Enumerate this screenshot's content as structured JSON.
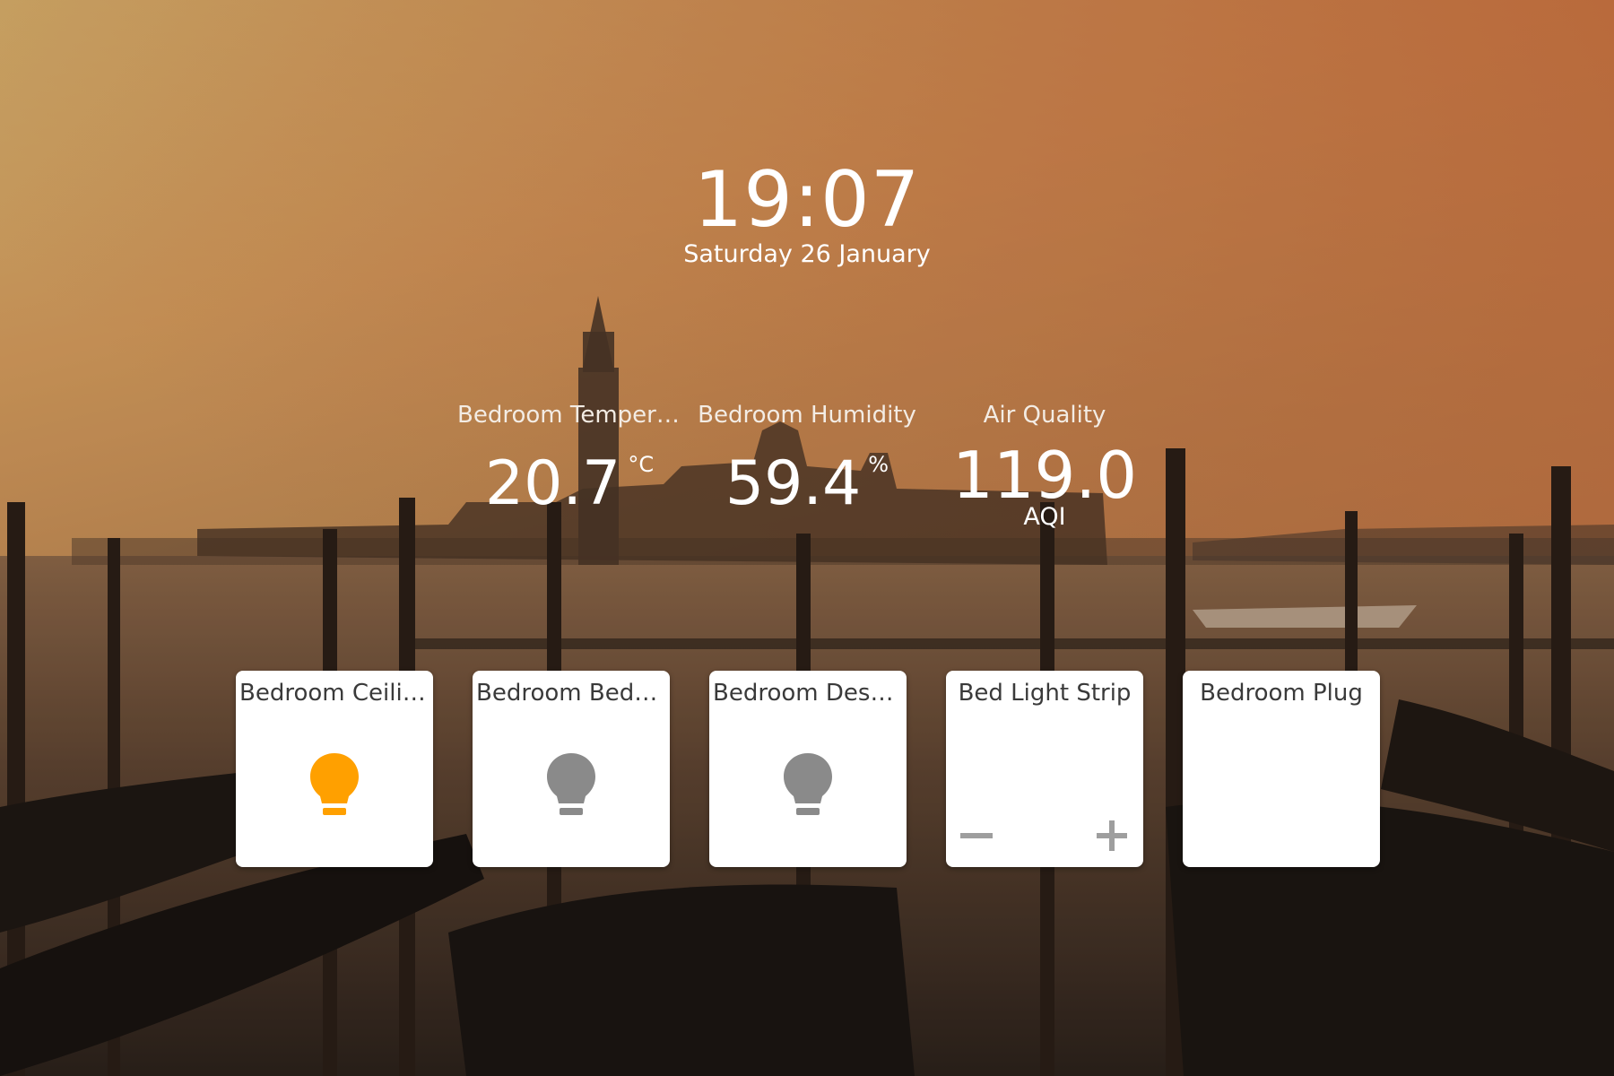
{
  "clock": {
    "time": "19:07",
    "date": "Saturday 26 January"
  },
  "sensors": [
    {
      "name": "Bedroom Temperature",
      "value": "20.7",
      "unit": "°C"
    },
    {
      "name": "Bedroom Humidity",
      "value": "59.4",
      "unit": "%"
    },
    {
      "name": "Air Quality",
      "value": "119.0",
      "unit": "AQI"
    }
  ],
  "tiles": [
    {
      "name": "Bedroom Ceiling",
      "icon": "lightbulb-icon",
      "state": "on"
    },
    {
      "name": "Bedroom Bedside",
      "icon": "lightbulb-icon",
      "state": "off"
    },
    {
      "name": "Bedroom Desk Lamp",
      "icon": "lightbulb-icon",
      "state": "off"
    },
    {
      "name": "Bed Light Strip",
      "controls": [
        "minus-icon",
        "plus-icon"
      ]
    },
    {
      "name": "Bedroom Plug"
    }
  ],
  "colors": {
    "bulb_on": "#FFA000",
    "bulb_off": "#8A8A8A",
    "control": "#9E9E9E"
  }
}
